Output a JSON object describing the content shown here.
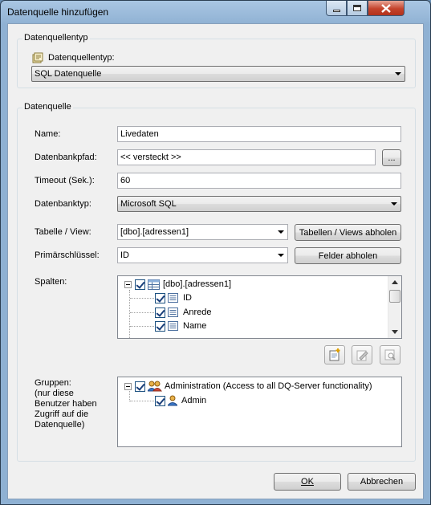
{
  "window": {
    "title": "Datenquelle hinzufügen"
  },
  "source_type_group": {
    "legend": "Datenquellentyp",
    "field_label": "Datenquellentyp:",
    "selected": "SQL Datenquelle"
  },
  "source_group": {
    "legend": "Datenquelle",
    "name": {
      "label": "Name:",
      "value": "Livedaten"
    },
    "db_path": {
      "label": "Datenbankpfad:",
      "value": "<< versteckt >>",
      "browse_label": "..."
    },
    "timeout": {
      "label": "Timeout (Sek.):",
      "value": "60"
    },
    "db_type": {
      "label": "Datenbanktyp:",
      "selected": "Microsoft SQL"
    },
    "table_view": {
      "label": "Tabelle / View:",
      "selected": "[dbo].[adressen1]",
      "fetch_label": "Tabellen / Views abholen"
    },
    "primary_key": {
      "label": "Primärschlüssel:",
      "selected": "ID",
      "fetch_label": "Felder abholen"
    },
    "columns": {
      "label": "Spalten:",
      "root": "[dbo].[adressen1]",
      "items": [
        "ID",
        "Anrede",
        "Name"
      ]
    },
    "groups": {
      "label": "Gruppen:\n(nur diese\nBenutzer haben\nZugriff auf die\nDatenquelle)",
      "root": "Administration (Access to all DQ-Server functionality)",
      "items": [
        "Admin"
      ]
    }
  },
  "footer": {
    "ok_label": "OK",
    "cancel_label": "Abbrechen"
  }
}
